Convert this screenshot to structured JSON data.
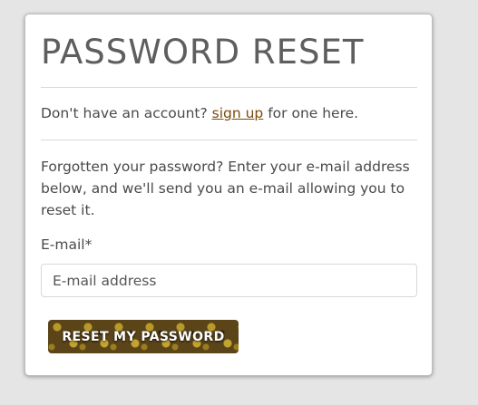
{
  "page": {
    "title": "PASSWORD RESET"
  },
  "signup": {
    "prefix": "Don't have an account?",
    "link_label": "sign up",
    "suffix": "for one here."
  },
  "instructions": "Forgotten your password? Enter your e-mail address below, and we'll send you an e-mail allowing you to reset it.",
  "form": {
    "email_label": "E-mail*",
    "email_placeholder": "E-mail address",
    "email_value": "",
    "submit_label": "RESET MY PASSWORD"
  },
  "colors": {
    "background": "#e5e5e5",
    "card": "#ffffff",
    "text": "#4a4a4a",
    "link": "#7a4a0c",
    "button": "#5a4418"
  }
}
